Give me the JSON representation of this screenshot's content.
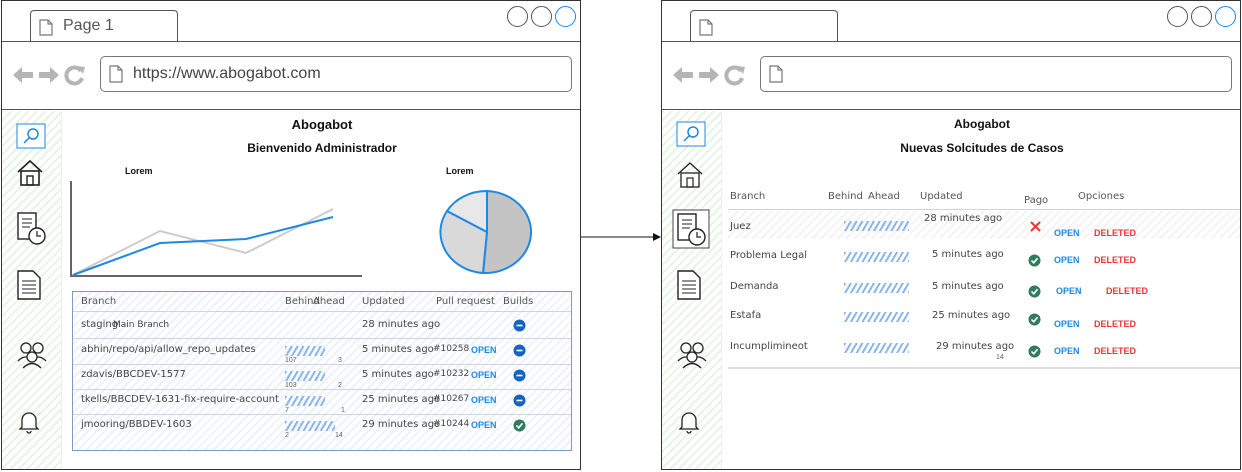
{
  "left_window": {
    "tab_title": "Page 1",
    "url": "https://www.abogabot.com",
    "app_title": "Abogabot",
    "subtitle": "Bienvenido Administrador",
    "line_chart_label": "Lorem",
    "pie_chart_label": "Lorem",
    "table": {
      "headers": [
        "Branch",
        "Behind",
        "Ahead",
        "Updated",
        "Pull request",
        "Builds"
      ],
      "rows": [
        {
          "branch": "staging",
          "branch_note": "Main Branch",
          "behind": "",
          "ahead": "",
          "updated": "28 minutes ago",
          "pr": "",
          "pr_status": "",
          "build": "minus"
        },
        {
          "branch": "abhin/repo/api/allow_repo_updates",
          "branch_note": "",
          "behind": "107",
          "ahead": "3",
          "updated": "5 minutes ago",
          "pr": "#10258",
          "pr_status": "OPEN",
          "build": "minus"
        },
        {
          "branch": "zdavis/BBCDEV-1577",
          "branch_note": "",
          "behind": "103",
          "ahead": "2",
          "updated": "5 minutes ago",
          "pr": "#10232",
          "pr_status": "OPEN",
          "build": "minus"
        },
        {
          "branch": "tkells/BBCDEV-1631-fix-require-account",
          "branch_note": "",
          "behind": "7",
          "ahead": "1",
          "updated": "25 minutes ago",
          "pr": "#10267",
          "pr_status": "OPEN",
          "build": "minus"
        },
        {
          "branch": "jmooring/BBDEV-1603",
          "branch_note": "",
          "behind": "2",
          "ahead": "14",
          "updated": "29 minutes ago",
          "pr": "#10244",
          "pr_status": "OPEN",
          "build": "check"
        }
      ]
    }
  },
  "right_window": {
    "tab_title": "",
    "url": "",
    "app_title": "Abogabot",
    "subtitle": "Nuevas Solcitudes de Casos",
    "table": {
      "headers": [
        "Branch",
        "Behind",
        "Ahead",
        "Updated",
        "Pago",
        "Opciones"
      ],
      "rows": [
        {
          "branch": "Juez",
          "updated": "28 minutes ago",
          "updated_extra": "",
          "pago": "x",
          "open": "OPEN",
          "deleted": "DELETED"
        },
        {
          "branch": "Problema Legal",
          "updated": "5 minutes ago",
          "updated_extra": "",
          "pago": "check",
          "open": "OPEN",
          "deleted": "DELETED"
        },
        {
          "branch": "Demanda",
          "updated": "5 minutes ago",
          "updated_extra": "",
          "pago": "check",
          "open": "OPEN",
          "deleted": "DELETED"
        },
        {
          "branch": "Estafa",
          "updated": "25 minutes ago",
          "updated_extra": "",
          "pago": "check",
          "open": "OPEN",
          "deleted": "DELETED"
        },
        {
          "branch": "Incumplimineot",
          "updated": "29 minutes ago",
          "updated_extra": "14",
          "pago": "check",
          "open": "OPEN",
          "deleted": "DELETED"
        }
      ]
    }
  },
  "colors": {
    "accent": "#1E88E5",
    "success": "#2e7d5b",
    "danger": "#e53935",
    "chart_grey": "#cccccc"
  }
}
